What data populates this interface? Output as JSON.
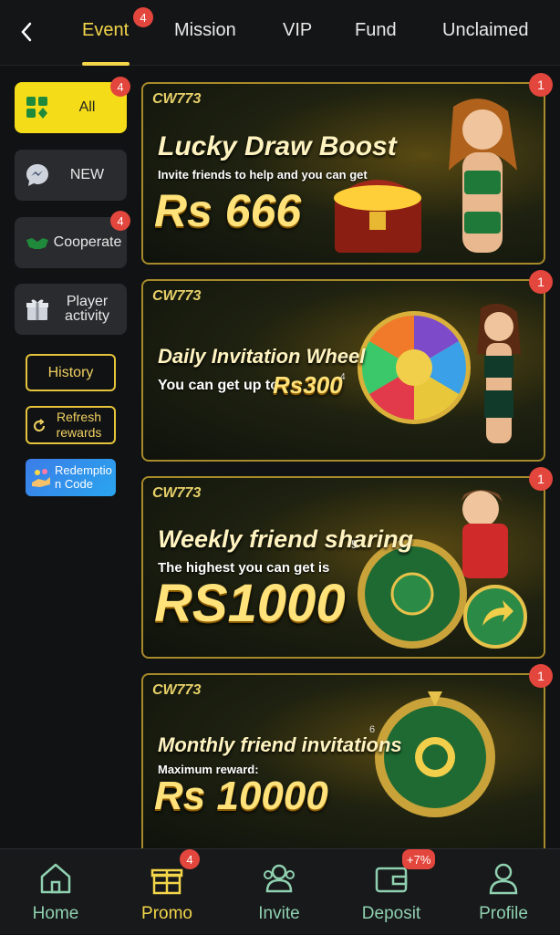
{
  "tabs": [
    {
      "label": "Event",
      "badge": "4"
    },
    {
      "label": "Mission"
    },
    {
      "label": "VIP"
    },
    {
      "label": "Fund"
    },
    {
      "label": "Unclaimed"
    }
  ],
  "sidebar": {
    "items": [
      {
        "label": "All",
        "badge": "4"
      },
      {
        "label": "NEW"
      },
      {
        "label": "Cooperate",
        "badge": "4"
      },
      {
        "label": "Player activity"
      }
    ],
    "history": "History",
    "refresh": "Refresh rewards",
    "redeem": "Redemption Code"
  },
  "banners": [
    {
      "logo": "CW773",
      "title": "Lucky Draw Boost",
      "subtitle": "Invite friends to help and you can get",
      "amount": "Rs 666",
      "badge": "1"
    },
    {
      "logo": "CW773",
      "title": "Daily Invitation Wheel",
      "subtitle": "You can get up to",
      "amount": "Rs300",
      "step": "4",
      "badge": "1"
    },
    {
      "logo": "CW773",
      "title": "Weekly friend sharing",
      "subtitle": "The highest you can get is",
      "amount": "RS1000",
      "step": "5",
      "badge": "1"
    },
    {
      "logo": "CW773",
      "title": "Monthly friend invitations",
      "subtitle": "Maximum reward:",
      "amount": "Rs 10000",
      "step": "6",
      "badge": "1"
    }
  ],
  "bottom_nav": [
    {
      "label": "Home"
    },
    {
      "label": "Promo",
      "badge": "4"
    },
    {
      "label": "Invite"
    },
    {
      "label": "Deposit",
      "badge": "+7%"
    },
    {
      "label": "Profile"
    }
  ],
  "colors": {
    "accent": "#f3d64a",
    "badge": "#e2463c",
    "nav": "#8fd1b0"
  }
}
